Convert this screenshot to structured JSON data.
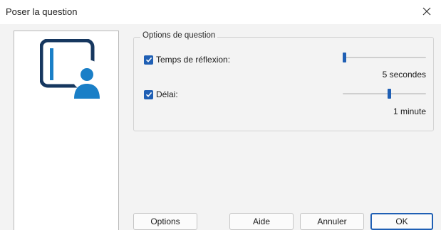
{
  "window": {
    "title": "Poser la question",
    "close_icon": "close-icon"
  },
  "illustration": {
    "icon": "question-person-icon",
    "colors": {
      "frame": "#16375f",
      "accent": "#1a7fc7"
    }
  },
  "options_group": {
    "legend": "Options de question",
    "think_time": {
      "label": "Temps de réflexion:",
      "checked": true,
      "value_text": "5 secondes",
      "slider_fraction": 0.0
    },
    "delay": {
      "label": "Délai:",
      "checked": true,
      "value_text": "1 minute",
      "slider_fraction": 0.56
    }
  },
  "buttons": {
    "options": "Options",
    "help": "Aide",
    "cancel": "Annuler",
    "ok": "OK"
  },
  "colors": {
    "accent": "#1f5fb4",
    "dialog_bg": "#f3f3f3"
  }
}
